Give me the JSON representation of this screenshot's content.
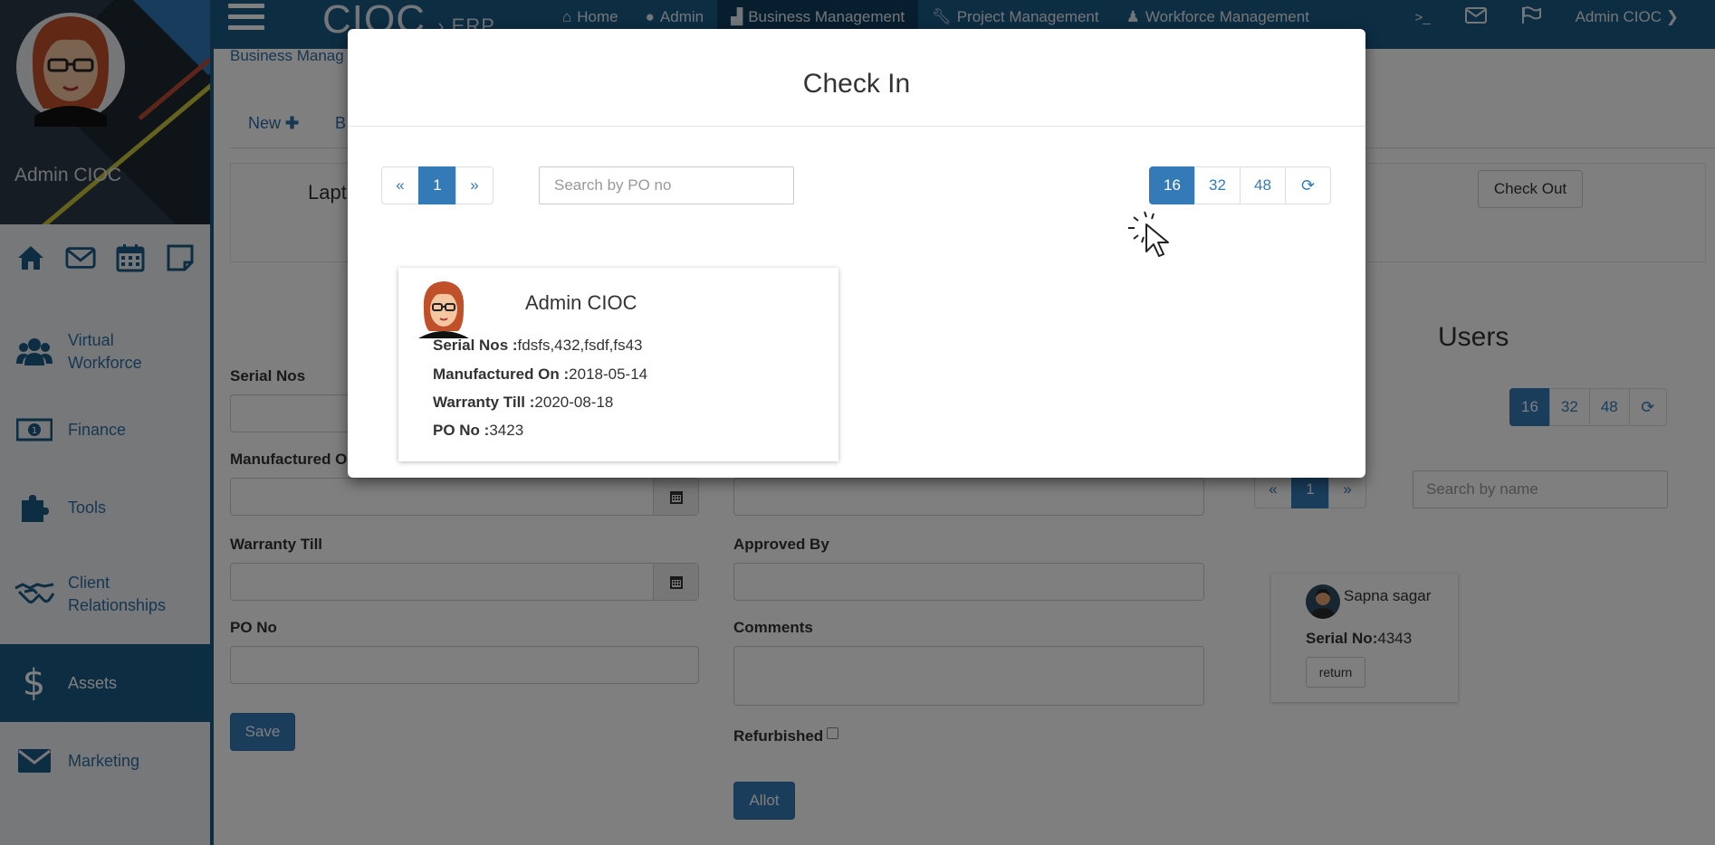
{
  "sidebar": {
    "profile_name": "Admin CIOC",
    "quick_icons": [
      "home-icon",
      "envelope-icon",
      "calendar-icon",
      "note-icon"
    ],
    "items": [
      {
        "label": "Virtual\nWorkforce",
        "icon": "users-icon"
      },
      {
        "label": "Finance",
        "icon": "money-icon"
      },
      {
        "label": "Tools",
        "icon": "puzzle-icon"
      },
      {
        "label": "Client\nRelationships",
        "icon": "handshake-icon"
      },
      {
        "label": "Assets",
        "icon": "dollar-icon",
        "active": true
      },
      {
        "label": "Marketing",
        "icon": "envelope-icon"
      }
    ]
  },
  "topbar": {
    "brand": "CIOC",
    "brand_sub": "› ERP",
    "nav": [
      {
        "label": "Home",
        "icon": "home-icon"
      },
      {
        "label": "Admin",
        "icon": "user-icon"
      },
      {
        "label": "Business Management",
        "icon": "chart-icon",
        "active": true
      },
      {
        "label": "Project Management",
        "icon": "wrench-icon"
      },
      {
        "label": "Workforce Management",
        "icon": "users-icon"
      }
    ],
    "terminal_icon": ">_",
    "user_label": "Admin CIOC"
  },
  "page": {
    "breadcrumb": "Business Manag",
    "tabs": {
      "new_label": "New",
      "second_label": "B"
    },
    "laptop_label": "Lapt",
    "check_out_label": "Check Out",
    "form_left": {
      "serial_nos_label": "Serial Nos",
      "manufactured_label": "Manufactured O",
      "warranty_label": "Warranty Till",
      "po_label": "PO No",
      "save_label": "Save"
    },
    "form_right": {
      "approved_by_label": "Approved By",
      "comments_label": "Comments",
      "refurbished_label": "Refurbished",
      "allot_label": "Allot"
    },
    "users": {
      "title": "Users",
      "page_sizes": [
        "16",
        "32",
        "48"
      ],
      "pager": [
        "«",
        "1",
        "»"
      ],
      "search_placeholder": "Search by name",
      "card": {
        "name": "Sapna sagar",
        "serial_label": "Serial No:",
        "serial_value": "4343",
        "return_label": "return"
      }
    }
  },
  "modal": {
    "title": "Check In",
    "pager": [
      "«",
      "1",
      "»"
    ],
    "search_placeholder": "Search by PO no",
    "page_sizes": [
      "16",
      "32",
      "48"
    ],
    "card": {
      "name": "Admin CIOC",
      "serial_label": "Serial Nos :",
      "serial_value": "fdsfs,432,fsdf,fs43",
      "manufactured_label": "Manufactured On :",
      "manufactured_value": "2018-05-14",
      "warranty_label": "Warranty Till :",
      "warranty_value": "2020-08-18",
      "po_label": "PO No :",
      "po_value": "3423"
    }
  },
  "colors": {
    "primary": "#337ab7",
    "nav_bg": "#1b5a86"
  }
}
